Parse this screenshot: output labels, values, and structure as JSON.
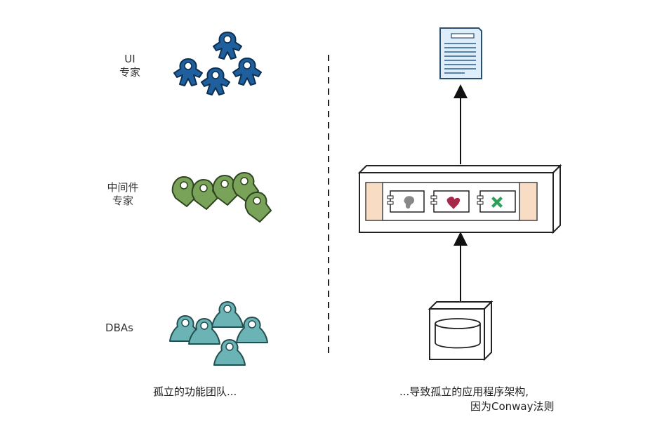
{
  "left": {
    "teams": [
      {
        "label_lines": [
          "UI",
          "专家"
        ],
        "icon": "blue-people-group-icon",
        "color": "#1f5f9e"
      },
      {
        "label_lines": [
          "中间件",
          "专家"
        ],
        "icon": "green-people-group-icon",
        "color": "#7aa35a"
      },
      {
        "label_lines": [
          "DBAs"
        ],
        "icon": "teal-people-group-icon",
        "color": "#6cb3b5"
      }
    ],
    "caption": "孤立的功能团队..."
  },
  "right": {
    "caption_line1": "...导致孤立的应用程序架构,",
    "caption_line2": "因为Conway法则",
    "components": [
      "document-icon",
      "server-box-icon",
      "database-icon"
    ],
    "colors": {
      "frame_fill": "#f9dcc4",
      "document_fill": "#ddeefa",
      "heart": "#a8284a",
      "cross": "#2ba05a",
      "blob": "#888888"
    }
  }
}
